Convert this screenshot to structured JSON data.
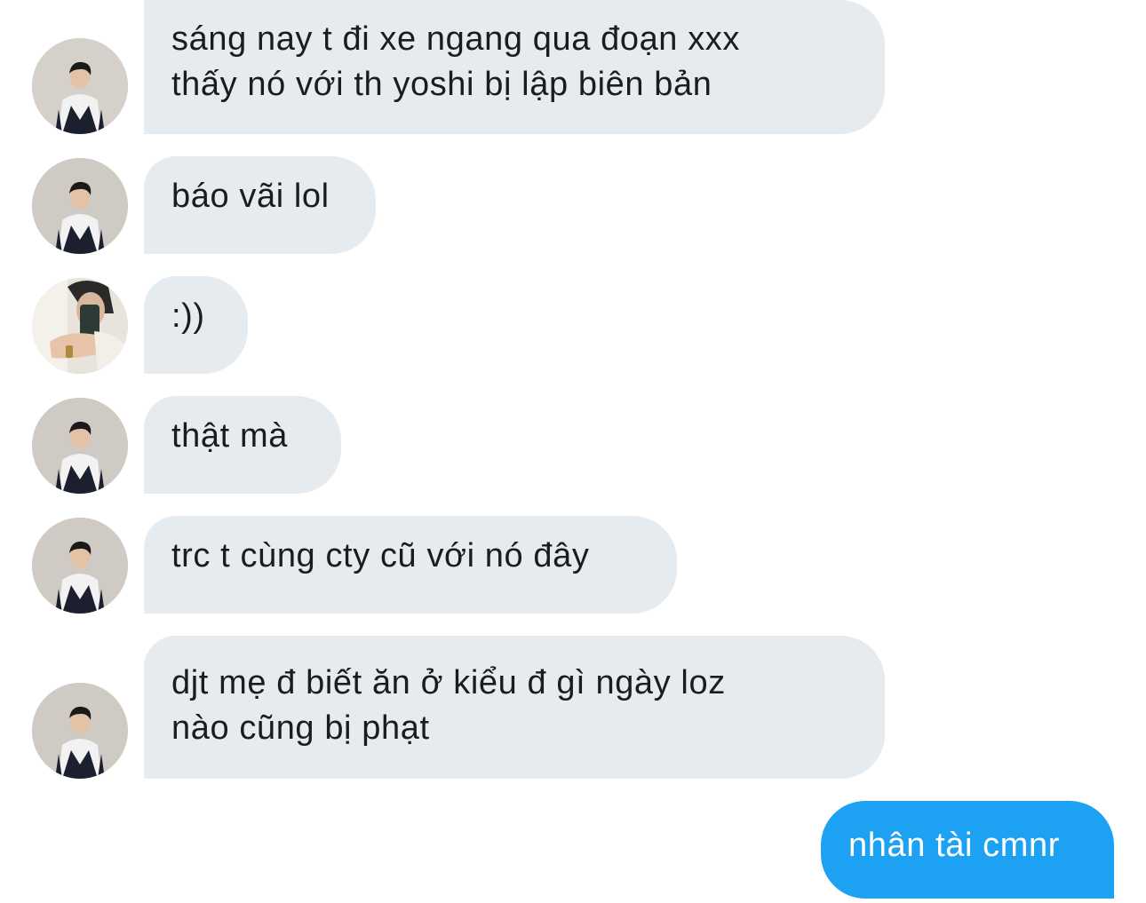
{
  "conversation": {
    "messages": [
      {
        "direction": "incoming",
        "sender": "friend-a",
        "lines": [
          "sáng nay t đi xe ngang qua đoạn xxx",
          "thấy nó với th yoshi bị lập biên bản"
        ]
      },
      {
        "direction": "incoming",
        "sender": "friend-a",
        "lines": [
          "báo vãi lol"
        ]
      },
      {
        "direction": "incoming",
        "sender": "friend-b",
        "lines": [
          ":))"
        ]
      },
      {
        "direction": "incoming",
        "sender": "friend-a",
        "lines": [
          "thật mà"
        ]
      },
      {
        "direction": "incoming",
        "sender": "friend-a",
        "lines": [
          "trc t cùng cty cũ với nó đây"
        ]
      },
      {
        "direction": "incoming",
        "sender": "friend-a",
        "lines": [
          "djt mẹ đ biết ăn ở kiểu đ gì ngày loz",
          "nào cũng bị phạt"
        ]
      },
      {
        "direction": "outgoing",
        "sender": "me",
        "lines": [
          "nhân tài cmnr"
        ]
      }
    ]
  },
  "colors": {
    "incoming_bubble": "#e6ebf0",
    "incoming_text": "#1c1c1e",
    "outgoing_bubble": "#1da1f2",
    "outgoing_text": "#ffffff",
    "background": "#ffffff"
  },
  "icons": {
    "friend-a": "avatar-person-jacket-icon",
    "friend-b": "avatar-mirror-selfie-icon"
  }
}
